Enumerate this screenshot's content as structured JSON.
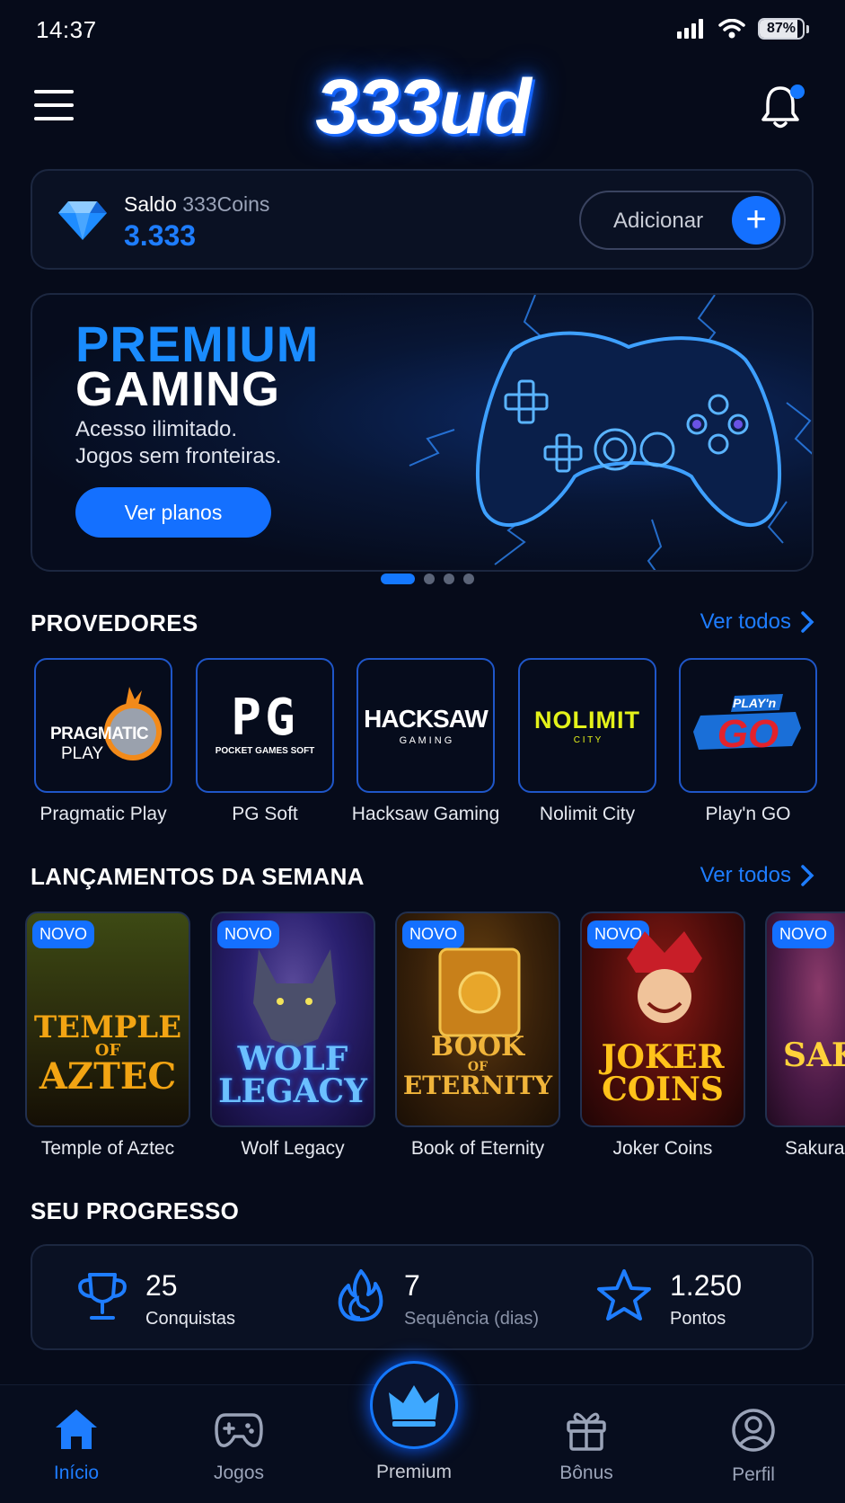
{
  "status_bar": {
    "time": "14:37",
    "battery": "87%",
    "battery_level": 0.87
  },
  "header": {
    "logo": "333ud",
    "has_notification": true
  },
  "balance": {
    "label": "Saldo",
    "currency": "333Coins",
    "value": "3.333",
    "add_label": "Adicionar"
  },
  "banner": {
    "title_line1": "PREMIUM",
    "title_line2": "GAMING",
    "subtitle_line1": "Acesso ilimitado.",
    "subtitle_line2": "Jogos sem fronteiras.",
    "cta": "Ver planos",
    "slides": 4,
    "active_slide": 1
  },
  "providers": {
    "title": "PROVEDORES",
    "see_all": "Ver todos",
    "items": [
      {
        "name": "Pragmatic Play",
        "logo_top": "PRAGMATIC",
        "logo_bottom": "PLAY"
      },
      {
        "name": "PG Soft",
        "logo_top": "PG",
        "logo_bottom": "POCKET GAMES SOFT"
      },
      {
        "name": "Hacksaw Gaming",
        "logo_top": "HACKSAW",
        "logo_bottom": "G A M I N G"
      },
      {
        "name": "Nolimit City",
        "logo_top": "NOLIMIT",
        "logo_bottom": "C I T Y"
      },
      {
        "name": "Play'n GO",
        "logo_top": "PLAY'n",
        "logo_bottom": "GO"
      }
    ]
  },
  "releases": {
    "title": "LANÇAMENTOS DA SEMANA",
    "see_all": "Ver todos",
    "badge": "NOVO",
    "items": [
      {
        "name": "Temple of Aztec",
        "art_line1": "TEMPLE",
        "art_line2": "OF",
        "art_line3": "AZTEC",
        "color": "#f2a413"
      },
      {
        "name": "Wolf Legacy",
        "art_line1": "WOLF",
        "art_line2": "",
        "art_line3": "LEGACY",
        "color": "#4aa8ff"
      },
      {
        "name": "Book of Eternity",
        "art_line1": "BOOK",
        "art_line2": "OF",
        "art_line3": "ETERNITY",
        "color": "#f0b43a"
      },
      {
        "name": "Joker Coins",
        "art_line1": "JOKER",
        "art_line2": "",
        "art_line3": "COINS",
        "color": "#ffc21a"
      },
      {
        "name": "Sakura",
        "art_line1": "SAK",
        "art_line2": "",
        "art_line3": "",
        "color": "#ffd23a"
      }
    ]
  },
  "progress": {
    "title": "SEU PROGRESSO",
    "stats": [
      {
        "icon": "trophy-icon",
        "value": "25",
        "label": "Conquistas"
      },
      {
        "icon": "flame-icon",
        "value": "7",
        "label": "Sequência (dias)"
      },
      {
        "icon": "star-icon",
        "value": "1.250",
        "label": "Pontos"
      }
    ]
  },
  "nav": {
    "items": [
      {
        "label": "Início",
        "icon": "home-icon",
        "active": true
      },
      {
        "label": "Jogos",
        "icon": "gamepad-icon",
        "active": false
      },
      {
        "label": "Premium",
        "icon": "crown-icon",
        "active": false
      },
      {
        "label": "Bônus",
        "icon": "gift-icon",
        "active": false
      },
      {
        "label": "Perfil",
        "icon": "user-icon",
        "active": false
      }
    ]
  },
  "colors": {
    "accent": "#1470ff",
    "background": "#060b1a"
  }
}
